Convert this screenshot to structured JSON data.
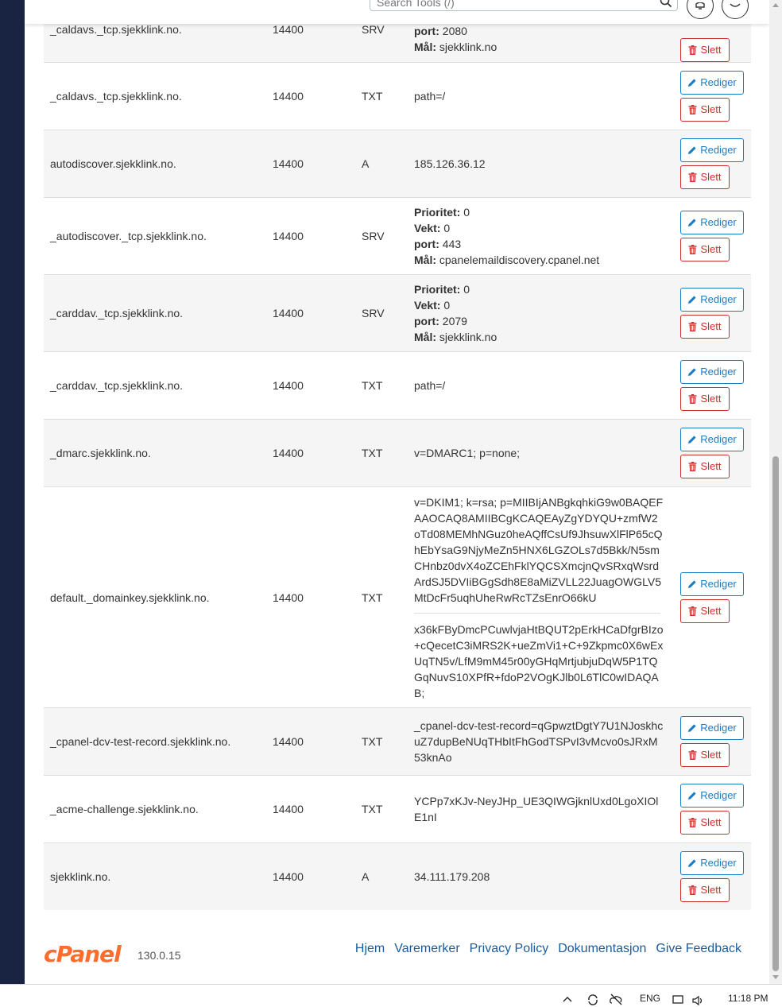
{
  "topbar": {
    "search_placeholder": "Search Tools (/)"
  },
  "actions": {
    "edit_label": "Rediger",
    "delete_label": "Slett"
  },
  "records": [
    {
      "name": "_caldavs._tcp.sjekklink.no.",
      "ttl": "14400",
      "type": "SRV",
      "kv": [
        {
          "k": "port:",
          "v": " 2080"
        },
        {
          "k": "Mål:",
          "v": " sjekklink.no"
        }
      ],
      "show_edit": false
    },
    {
      "name": "_caldavs._tcp.sjekklink.no.",
      "ttl": "14400",
      "type": "TXT",
      "value": "path=/",
      "show_edit": true
    },
    {
      "name": "autodiscover.sjekklink.no.",
      "ttl": "14400",
      "type": "A",
      "value": "185.126.36.12",
      "show_edit": true
    },
    {
      "name": "_autodiscover._tcp.sjekklink.no.",
      "ttl": "14400",
      "type": "SRV",
      "kv": [
        {
          "k": "Prioritet:",
          "v": " 0"
        },
        {
          "k": "Vekt:",
          "v": " 0"
        },
        {
          "k": "port:",
          "v": " 443"
        },
        {
          "k": "Mål:",
          "v": " cpanelemaildiscovery.cpanel.net"
        }
      ],
      "show_edit": true
    },
    {
      "name": "_carddav._tcp.sjekklink.no.",
      "ttl": "14400",
      "type": "SRV",
      "kv": [
        {
          "k": "Prioritet:",
          "v": " 0"
        },
        {
          "k": "Vekt:",
          "v": " 0"
        },
        {
          "k": "port:",
          "v": " 2079"
        },
        {
          "k": "Mål:",
          "v": " sjekklink.no"
        }
      ],
      "show_edit": true
    },
    {
      "name": "_carddav._tcp.sjekklink.no.",
      "ttl": "14400",
      "type": "TXT",
      "value": "path=/",
      "show_edit": true
    },
    {
      "name": "_dmarc.sjekklink.no.",
      "ttl": "14400",
      "type": "TXT",
      "value": "v=DMARC1; p=none;",
      "show_edit": true
    },
    {
      "name": "default._domainkey.sjekklink.no.",
      "ttl": "14400",
      "type": "TXT",
      "segments": [
        "v=DKIM1; k=rsa; p=MIIBIjANBgkqhkiG9w0BAQEFAAOCAQ8AMIIBCgKCAQEAyZgYDYQU+zmfW2oTd08MEMhNGuz0heAQffCsUf9JhsuwXlFlP65cQhEbYsaG9NjyMeZn5HNX6LGZOLs7d5Bkk/N5smCHnbz0dvX4oZCEhFklYQCSXmcjnQvSRxqWsrdArdSJ5DVIiBGgSdh8E8aMiZVLL22JuagOWGLV5MtDcFr5uqhUheRwRcTZsEnrO66kU",
        "x36kFByDmcPCuwlvjaHtBQUT2pErkHCaDfgrBIzo+cQecetC3iMRS2K+ueZmVi1+C+9Zkpmc0X6wExUqTN5v/LfM9mM45r00yGHqMrtjubjuDqW5P1TQGqNuvS10XPfR+fdoP2VOgKJlb0L6TlC0wIDAQAB;"
      ],
      "show_edit": true
    },
    {
      "name": "_cpanel-dcv-test-record.sjekklink.no.",
      "ttl": "14400",
      "type": "TXT",
      "value": "_cpanel-dcv-test-record=qGpwztDgtY7U1NJoskhcuZ7dupBeNUqTHbItFhGodTSPvI3vMcvo0sJRxM53knAo",
      "show_edit": true
    },
    {
      "name": "_acme-challenge.sjekklink.no.",
      "ttl": "14400",
      "type": "TXT",
      "value": "YCPp7xKJv-NeyJHp_UE3QIWGjknlUxd0LgoXIOlE1nI",
      "show_edit": true
    },
    {
      "name": "sjekklink.no.",
      "ttl": "14400",
      "type": "A",
      "value": "34.111.179.208",
      "show_edit": true
    }
  ],
  "footer": {
    "logo": "cPanel",
    "version": "130.0.15",
    "links": [
      "Hjem",
      "Varemerker",
      "Privacy Policy",
      "Dokumentasjon",
      "Give Feedback"
    ]
  },
  "taskbar": {
    "lang": "ENG",
    "time": "11:18 PM"
  },
  "colors": {
    "edit": "#1a7dc4",
    "delete": "#c9302c",
    "brand": "#ff6c2c",
    "row_alt": "#f5f5f5"
  }
}
